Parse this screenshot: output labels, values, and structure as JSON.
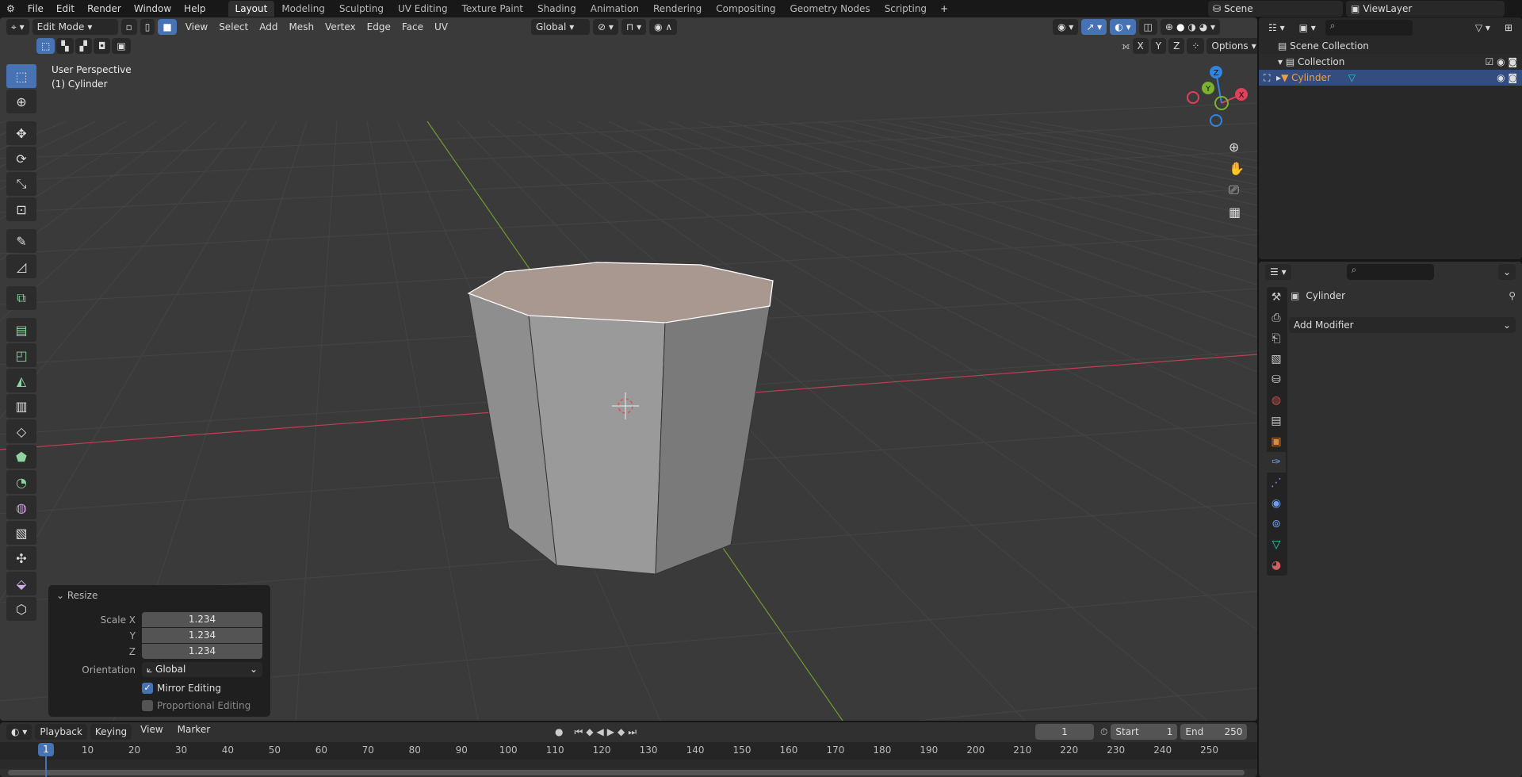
{
  "menubar": {
    "items": [
      "File",
      "Edit",
      "Render",
      "Window",
      "Help"
    ],
    "workspaces": [
      "Layout",
      "Modeling",
      "Sculpting",
      "UV Editing",
      "Texture Paint",
      "Shading",
      "Animation",
      "Rendering",
      "Compositing",
      "Geometry Nodes",
      "Scripting"
    ],
    "active_workspace": "Layout",
    "add_icon": "+",
    "scene": "Scene",
    "view_layer": "ViewLayer"
  },
  "viewport_header": {
    "mode": "Edit Mode",
    "menus": [
      "View",
      "Select",
      "Add",
      "Mesh",
      "Vertex",
      "Edge",
      "Face",
      "UV"
    ],
    "orientation": "Global",
    "axes": [
      "X",
      "Y",
      "Z"
    ],
    "options": "Options"
  },
  "overlay": {
    "view_name": "User Perspective",
    "object": "(1) Cylinder"
  },
  "gizmo": {
    "z": "Z",
    "y": "Y",
    "x": "X"
  },
  "resize_panel": {
    "title": "Resize",
    "scale_x_label": "Scale X",
    "y_label": "Y",
    "z_label": "Z",
    "scale_x": "1.234",
    "scale_y": "1.234",
    "scale_z": "1.234",
    "orientation_label": "Orientation",
    "orientation": "Global",
    "mirror_editing": "Mirror Editing",
    "mirror_checked": true,
    "proportional_editing": "Proportional Editing",
    "proportional_checked": false
  },
  "timeline": {
    "menus": [
      "Playback",
      "Keying",
      "View",
      "Marker"
    ],
    "current_frame": "1",
    "start_label": "Start",
    "start": "1",
    "end_label": "End",
    "end": "250",
    "ticks": [
      "10",
      "20",
      "30",
      "40",
      "50",
      "60",
      "70",
      "80",
      "90",
      "100",
      "110",
      "120",
      "130",
      "140",
      "150",
      "160",
      "170",
      "180",
      "190",
      "200",
      "210",
      "220",
      "230",
      "240",
      "250"
    ]
  },
  "outliner": {
    "scene_collection": "Scene Collection",
    "collection": "Collection",
    "object": "Cylinder"
  },
  "properties": {
    "object": "Cylinder",
    "add_modifier": "Add Modifier",
    "active_tab": "modifier"
  },
  "colors": {
    "accent": "#4772b3",
    "x_axis": "#e0405a",
    "y_axis": "#7ab32d",
    "z_axis": "#2f85e3",
    "selected_face": "#a99890",
    "object_text": "#f0a040"
  }
}
